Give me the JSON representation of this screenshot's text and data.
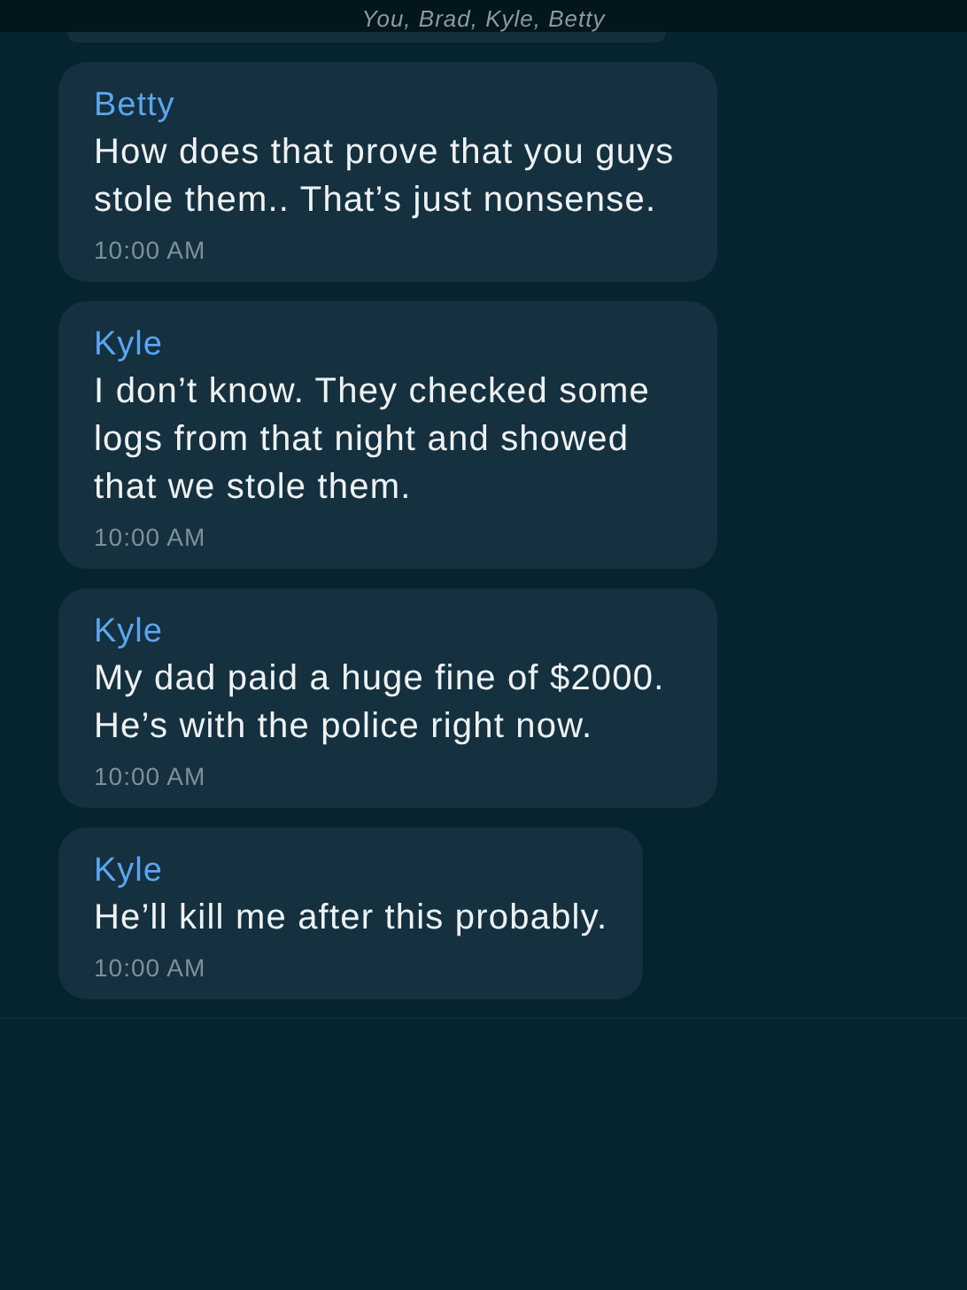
{
  "header": {
    "subtitle": "You, Brad, Kyle, Betty"
  },
  "messages": [
    {
      "sender": "Betty",
      "text": "How does that prove that you guys stole them.. That’s just nonsense.",
      "time": "10:00 AM"
    },
    {
      "sender": "Kyle",
      "text": "I don’t know. They checked some logs from that night and showed that we stole them.",
      "time": "10:00 AM"
    },
    {
      "sender": "Kyle",
      "text": "My dad paid a huge fine of $2000. He’s with the police right now.",
      "time": "10:00 AM"
    },
    {
      "sender": "Kyle",
      "text": "He’ll kill me after this probably.",
      "time": "10:00 AM"
    }
  ]
}
